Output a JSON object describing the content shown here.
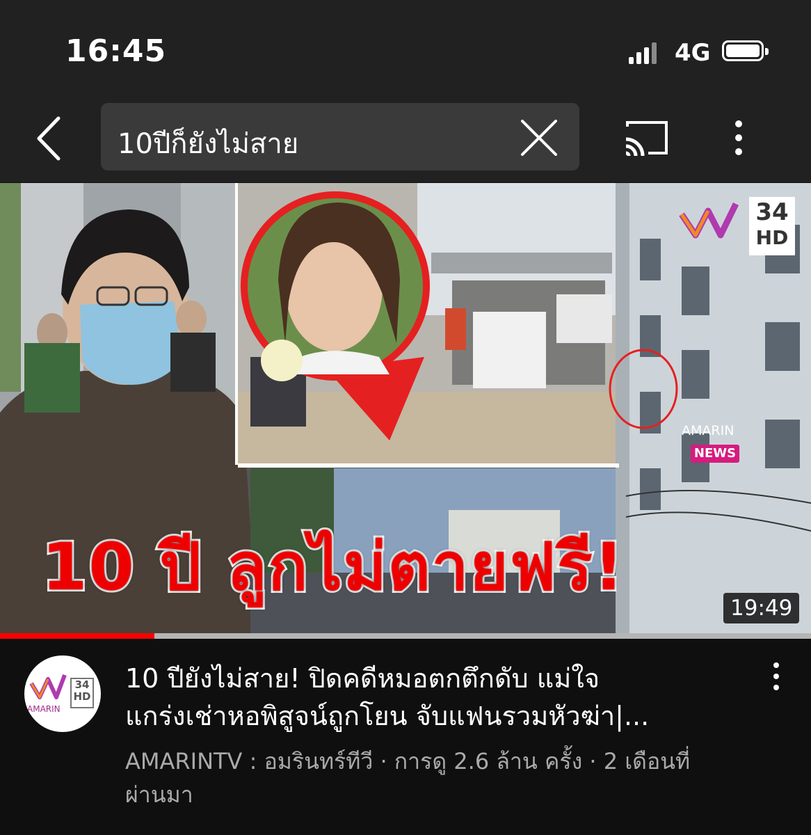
{
  "status_bar": {
    "time": "16:45",
    "network": "4G"
  },
  "search": {
    "query": "10ปีก็ยังไม่สาย"
  },
  "icons": {
    "back": "chevron-left-icon",
    "clear": "close-icon",
    "cast": "cast-icon",
    "more": "more-vert-icon"
  },
  "video": {
    "overlay_text": "10 ปี ลูกไม่ตายฟรี!",
    "logo_brand": "AMARIN",
    "logo_news": "NEWS",
    "logo_channel_number": "34",
    "logo_channel_hd": "HD",
    "duration": "19:49",
    "progress": 0.19,
    "title_line1": "10 ปียังไม่สาย! ปิดคดีหมอตกตึกดับ แม่ใจ",
    "title_line2": "แกร่งเช่าหอพิสูจน์ถูกโยน จับแฟนรวมหัวฆ่า|...",
    "meta_line1": "AMARINTV : อมรินทร์ทีวี · การดู 2.6 ล้าน ครั้ง · 2 เดือนที่",
    "meta_line2": "ผ่านมา",
    "avatar_brand": "AMARIN",
    "avatar_channel_number": "34",
    "avatar_channel_hd": "HD"
  },
  "colors": {
    "background": "#0f0f0f",
    "header": "#212121",
    "progress_played": "#ff0000",
    "overlay_text": "#e00000",
    "meta_text": "#aaaaaa"
  }
}
